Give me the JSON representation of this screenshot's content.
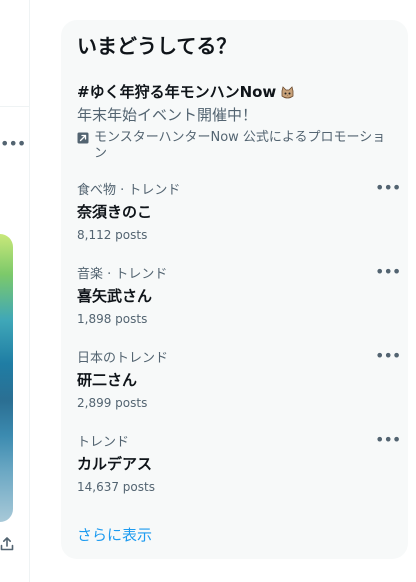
{
  "sidebar": {
    "title": "いまどうしてる？",
    "promoted": {
      "title": "#ゆく年狩る年モンハンNow",
      "subtitle": "年末年始イベント開催中！",
      "promoted_by": "モンスターハンターNow 公式によるプロモーション"
    },
    "trends": [
      {
        "meta": "食べ物 · トレンド",
        "name": "奈須きのこ",
        "count": "8,112 posts"
      },
      {
        "meta": "音楽 · トレンド",
        "name": "喜矢武さん",
        "count": "1,898 posts"
      },
      {
        "meta": "日本のトレンド",
        "name": "研二さん",
        "count": "2,899 posts"
      },
      {
        "meta": "トレンド",
        "name": "カルデアス",
        "count": "14,637 posts"
      }
    ],
    "show_more": "さらに表示",
    "more_glyph": "•••"
  },
  "colors": {
    "accent": "#1d9bf0",
    "card_bg": "#f7f9f9",
    "secondary_text": "#536471",
    "primary_text": "#0f1419"
  },
  "icons": {
    "more": "more-icon",
    "promoted": "promoted-icon",
    "share": "share-icon",
    "cat_emoji": "cat-icon"
  }
}
